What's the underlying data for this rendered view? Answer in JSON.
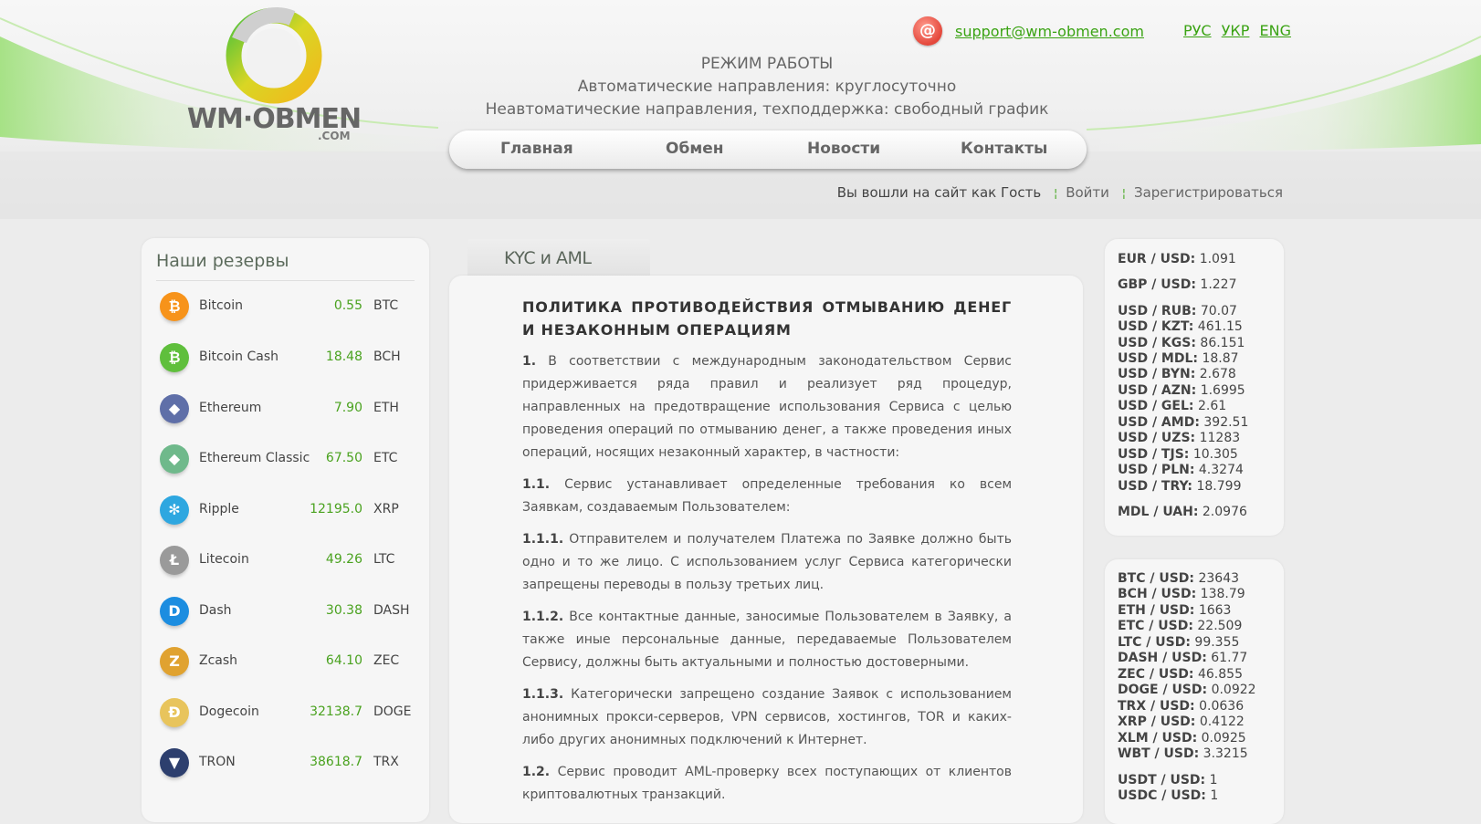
{
  "logo": {
    "text": "WM·OBMEN",
    "sub": ".COM"
  },
  "contact": {
    "email": "support@wm-obmen.com"
  },
  "languages": [
    "РУС",
    "УКР",
    "ENG"
  ],
  "work_hours": {
    "title": "РЕЖИМ РАБОТЫ",
    "line1": "Автоматические направления: круглосуточно",
    "line2": "Неавтоматические направления, техподдержка: свободный график"
  },
  "nav": {
    "home": "Главная",
    "exchange": "Обмен",
    "news": "Новости",
    "contacts": "Контакты"
  },
  "auth": {
    "status": "Вы вошли на сайт как Гость",
    "login": "Войти",
    "register": "Зарегистрироваться"
  },
  "reserves": {
    "title": "Наши резервы",
    "items": [
      {
        "name": "Bitcoin",
        "amount": "0.55",
        "code": "BTC",
        "icon": "bitcoin-icon",
        "color": "#f7931a",
        "glyph": "₿"
      },
      {
        "name": "Bitcoin Cash",
        "amount": "18.48",
        "code": "BCH",
        "icon": "bitcoin-cash-icon",
        "color": "#5fbf3c",
        "glyph": "₿"
      },
      {
        "name": "Ethereum",
        "amount": "7.90",
        "code": "ETH",
        "icon": "ethereum-icon",
        "color": "#5f6fa8",
        "glyph": "◆"
      },
      {
        "name": "Ethereum Classic",
        "amount": "67.50",
        "code": "ETC",
        "icon": "ethereum-classic-icon",
        "color": "#6fb98b",
        "glyph": "◆"
      },
      {
        "name": "Ripple",
        "amount": "12195.0",
        "code": "XRP",
        "icon": "ripple-icon",
        "color": "#2ea7e0",
        "glyph": "✻"
      },
      {
        "name": "Litecoin",
        "amount": "49.26",
        "code": "LTC",
        "icon": "litecoin-icon",
        "color": "#9a9a9a",
        "glyph": "Ł"
      },
      {
        "name": "Dash",
        "amount": "30.38",
        "code": "DASH",
        "icon": "dash-icon",
        "color": "#1c8de0",
        "glyph": "D"
      },
      {
        "name": "Zcash",
        "amount": "64.10",
        "code": "ZEC",
        "icon": "zcash-icon",
        "color": "#e0a230",
        "glyph": "Z"
      },
      {
        "name": "Dogecoin",
        "amount": "32138.7",
        "code": "DOGE",
        "icon": "dogecoin-icon",
        "color": "#e8c45c",
        "glyph": "Ð"
      },
      {
        "name": "TRON",
        "amount": "38618.7",
        "code": "TRX",
        "icon": "tron-icon",
        "color": "#2d3f6e",
        "glyph": "▼"
      }
    ]
  },
  "page_tab": "KYC и AML",
  "article": {
    "title": "ПОЛИТИКА ПРОТИВОДЕЙСТВИЯ ОТМЫВАНИЮ ДЕНЕГ И НЕЗАКОННЫМ ОПЕРАЦИЯМ",
    "paragraphs": [
      {
        "num": "1.",
        "text": "В соответствии с международным законодательством Сервис придерживается ряда правил и реализует ряд процедур, направленных на предотвращение использования Сервиса с целью проведения операций по отмыванию денег, а также проведения иных операций, носящих незаконный характер, в частности:"
      },
      {
        "num": "1.1.",
        "text": "Сервис устанавливает определенные требования ко всем Заявкам, создаваемым Пользователем:"
      },
      {
        "num": "1.1.1.",
        "text": "Отправителем и получателем Платежа по Заявке должно быть одно и то же лицо. С использованием услуг Сервиса категорически запрещены переводы в пользу третьих лиц."
      },
      {
        "num": "1.1.2.",
        "text": "Все контактные данные, заносимые Пользователем в Заявку, а также иные персональные данные, передаваемые Пользователем Сервису, должны быть актуальными и полностью достоверными."
      },
      {
        "num": "1.1.3.",
        "text": "Категорически запрещено создание Заявок с использованием анонимных прокси-серверов, VPN сервисов, хостингов, TOR и каких-либо других анонимных подключений к Интернет."
      },
      {
        "num": "1.2.",
        "text": "Сервис проводит AML-проверку всех поступающих от клиентов криптовалютных транзакций."
      }
    ]
  },
  "fiat_rates": [
    {
      "pair": "EUR / USD:",
      "value": "1.091"
    },
    {
      "pair": "GBP / USD:",
      "value": "1.227"
    },
    {
      "pair": "USD / RUB:",
      "value": "70.07"
    },
    {
      "pair": "USD / KZT:",
      "value": "461.15"
    },
    {
      "pair": "USD / KGS:",
      "value": "86.151"
    },
    {
      "pair": "USD / MDL:",
      "value": "18.87"
    },
    {
      "pair": "USD / BYN:",
      "value": "2.678"
    },
    {
      "pair": "USD / AZN:",
      "value": "1.6995"
    },
    {
      "pair": "USD / GEL:",
      "value": "2.61"
    },
    {
      "pair": "USD / AMD:",
      "value": "392.51"
    },
    {
      "pair": "USD / UZS:",
      "value": "11283"
    },
    {
      "pair": "USD / TJS:",
      "value": "10.305"
    },
    {
      "pair": "USD / PLN:",
      "value": "4.3274"
    },
    {
      "pair": "USD / TRY:",
      "value": "18.799"
    },
    {
      "pair": "MDL / UAH:",
      "value": "2.0976"
    }
  ],
  "crypto_rates": [
    {
      "pair": "BTC / USD:",
      "value": "23643"
    },
    {
      "pair": "BCH / USD:",
      "value": "138.79"
    },
    {
      "pair": "ETH / USD:",
      "value": "1663"
    },
    {
      "pair": "ETC / USD:",
      "value": "22.509"
    },
    {
      "pair": "LTC / USD:",
      "value": "99.355"
    },
    {
      "pair": "DASH / USD:",
      "value": "61.77"
    },
    {
      "pair": "ZEC / USD:",
      "value": "46.855"
    },
    {
      "pair": "DOGE / USD:",
      "value": "0.0922"
    },
    {
      "pair": "TRX / USD:",
      "value": "0.0636"
    },
    {
      "pair": "XRP / USD:",
      "value": "0.4122"
    },
    {
      "pair": "XLM / USD:",
      "value": "0.0925"
    },
    {
      "pair": "WBT / USD:",
      "value": "3.3215"
    },
    {
      "pair": "USDT / USD:",
      "value": "1"
    },
    {
      "pair": "USDC / USD:",
      "value": "1"
    }
  ],
  "colors": {
    "accent": "#3aa313",
    "link": "#3aa313",
    "swoosh": "#8fd36a"
  }
}
